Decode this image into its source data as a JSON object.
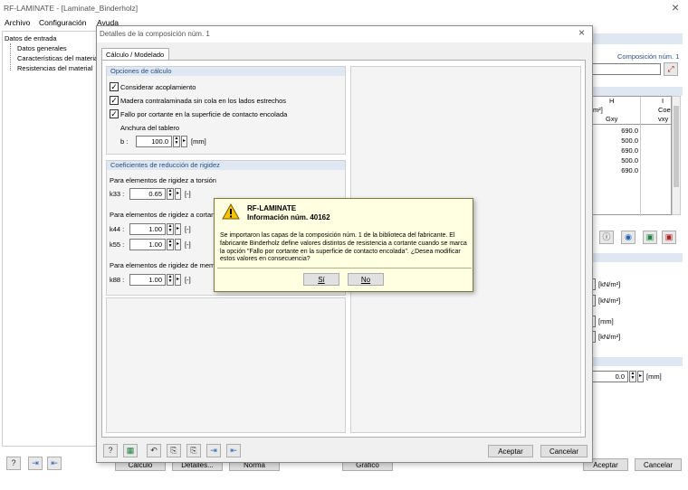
{
  "app": {
    "title": "RF-LAMINATE - [Laminate_Binderholz]",
    "menu": [
      "Archivo",
      "Configuración",
      "Ayuda"
    ],
    "close_glyph": "×",
    "tree": [
      "Datos de entrada",
      "Datos generales",
      "Características del material",
      "Resistencias del material"
    ],
    "composition_label": "Composición núm. 1",
    "table": {
      "col_h": "H",
      "col_i": "I",
      "unit": "m²]",
      "col_coe": "Coe",
      "col_gxy": "Gxy",
      "col_vxy": "vxy",
      "values": [
        "690.0",
        "500.0",
        "690.0",
        "500.0",
        "690.0"
      ]
    },
    "units": [
      "[kN/m²]",
      "[kN/m²]",
      "[mm]",
      "[kN/m²]",
      "[mm]"
    ],
    "bottom_value": "0.0",
    "bottom_buttons": [
      "Cálculo",
      "Detalles...",
      "Norma",
      "Gráfico"
    ],
    "accept": "Aceptar",
    "cancel": "Cancelar"
  },
  "dialog": {
    "title": "Detalles de la composición núm. 1",
    "tab": "Cálculo / Modelado",
    "calc_options": {
      "header": "Opciones de cálculo",
      "checks": [
        "Considerar acoplamiento",
        "Madera contralaminada sin cola en los lados estrechos",
        "Fallo por cortante en la superficie de contacto encolada"
      ],
      "board_width_label": "Anchura del tablero",
      "b_label": "b :",
      "b_value": "100.0",
      "b_unit": "[mm]"
    },
    "stiffness": {
      "header": "Coeficientes de reducción de rigidez",
      "torsion_label": "Para elementos de rigidez a torsión",
      "k33_label": "k33 :",
      "k33_value": "0.65",
      "shear_label": "Para elementos de rigidez a cortante",
      "k44_label": "k44 :",
      "k44_value": "1.00",
      "k55_label": "k55 :",
      "k55_value": "1.00",
      "membrane_label": "Para elementos de rigidez de membrana",
      "k88_label": "k88 :",
      "k88_value": "1.00",
      "unit": "[-]"
    },
    "accept": "Aceptar",
    "cancel": "Cancelar"
  },
  "message": {
    "title": "RF-LAMINATE",
    "subtitle": "Información núm. 40162",
    "body": "Se importaron las capas de la composición núm. 1 de la biblioteca del fabricante. El fabricante Binderholz define valores distintos de resistencia a cortante cuando se marca la opción \"Fallo por cortante en la superficie de contacto encolada\". ¿Desea modificar estos valores en consecuencia?",
    "yes": "Sí",
    "no": "No"
  }
}
